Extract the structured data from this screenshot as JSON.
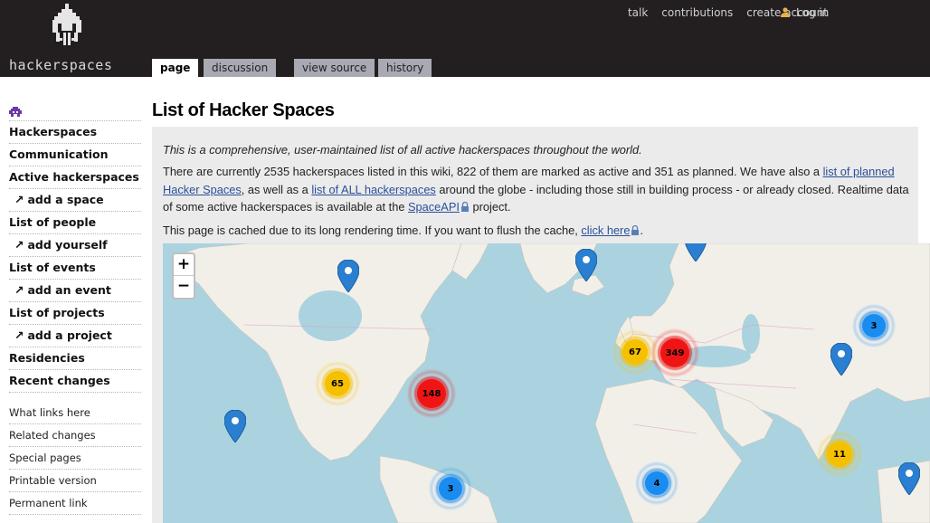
{
  "site": {
    "logo_text": "hackerspaces"
  },
  "personal": {
    "talk": "talk",
    "contributions": "contributions",
    "create_account": "create account",
    "login": "Log in"
  },
  "tabs": {
    "page": "page",
    "discussion": "discussion",
    "view_source": "view source",
    "history": "history"
  },
  "sidebar": {
    "nav": [
      {
        "label": "Hackerspaces",
        "sub": false
      },
      {
        "label": "Communication",
        "sub": false
      },
      {
        "label": "Active hackerspaces",
        "sub": false
      },
      {
        "label": "add a space",
        "sub": true
      },
      {
        "label": "List of people",
        "sub": false
      },
      {
        "label": "add yourself",
        "sub": true
      },
      {
        "label": "List of events",
        "sub": false
      },
      {
        "label": "add an event",
        "sub": true
      },
      {
        "label": "List of projects",
        "sub": false
      },
      {
        "label": "add a project",
        "sub": true
      },
      {
        "label": "Residencies",
        "sub": false
      },
      {
        "label": "Recent changes",
        "sub": false
      }
    ],
    "arrow": "↗",
    "tools": [
      "What links here",
      "Related changes",
      "Special pages",
      "Printable version",
      "Permanent link"
    ]
  },
  "page": {
    "title": "List of Hacker Spaces",
    "intro": "This is a comprehensive, user-maintained list of all active hackerspaces throughout the world.",
    "count_1": "There are currently 2535 hackerspaces listed in this wiki, 822 of them are marked as active and 351 as planned. We have also a ",
    "link_planned": "list of planned Hacker Spaces",
    "count_2": ", as well as a ",
    "link_all": "list of ALL hackerspaces",
    "count_3": " around the globe - including those still in building process - or already closed. Realtime data of some active hackerspaces is available at the ",
    "link_spaceapi": "SpaceAPI",
    "count_4": " project.",
    "cache_1": "This page is cached due to its long rendering time. If you want to flush the cache, ",
    "link_click_here": "click here",
    "cache_2": "."
  },
  "map": {
    "zoom_in": "+",
    "zoom_out": "−",
    "clusters": [
      {
        "count": "65",
        "level": "medium"
      },
      {
        "count": "148",
        "level": "large"
      },
      {
        "count": "67",
        "level": "medium"
      },
      {
        "count": "349",
        "level": "large"
      },
      {
        "count": "3",
        "level": "small"
      },
      {
        "count": "11",
        "level": "medium"
      },
      {
        "count": "3",
        "level": "small"
      },
      {
        "count": "4",
        "level": "small"
      }
    ],
    "colors": {
      "small": "#1a8cf0",
      "medium": "#f5c000",
      "large": "#f01515",
      "pin": "#2a7fd0",
      "water": "#aad3df",
      "land": "#f2efe9"
    }
  }
}
